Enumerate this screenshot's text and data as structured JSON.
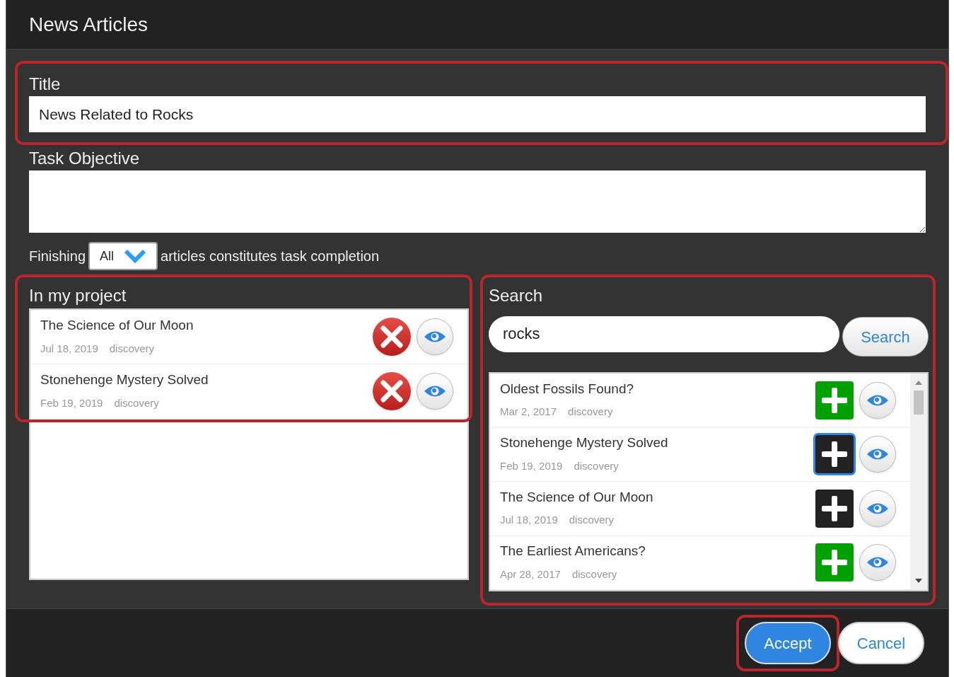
{
  "window": {
    "title": "News Articles"
  },
  "title_field": {
    "label": "Title",
    "value": "News Related to Rocks",
    "highlighted": true
  },
  "objective_field": {
    "label": "Task Objective"
  },
  "completion": {
    "prefix": "Finishing",
    "dropdown": "All",
    "suffix": "articles constitutes task completion"
  },
  "project": {
    "heading": "In my project",
    "highlighted": true,
    "items": [
      {
        "title": "The Science of Our Moon",
        "date": "Jul 18, 2019",
        "source": "discovery"
      },
      {
        "title": "Stonehenge Mystery Solved",
        "date": "Feb 19, 2019",
        "source": "discovery"
      }
    ]
  },
  "search": {
    "heading": "Search",
    "query": "rocks",
    "button": "Search",
    "highlighted": true,
    "results": [
      {
        "title": "Oldest Fossils Found?",
        "date": "Mar 2, 2017",
        "source": "discovery",
        "added": false,
        "focused": false
      },
      {
        "title": "Stonehenge Mystery Solved",
        "date": "Feb 19, 2019",
        "source": "discovery",
        "added": true,
        "focused": true
      },
      {
        "title": "The Science of Our Moon",
        "date": "Jul 18, 2019",
        "source": "discovery",
        "added": true,
        "focused": false
      },
      {
        "title": "The Earliest Americans?",
        "date": "Apr 28, 2017",
        "source": "discovery",
        "added": false,
        "focused": false
      }
    ]
  },
  "footer": {
    "buttons": [
      {
        "label": "Accept",
        "kind": "primary",
        "highlighted": true
      },
      {
        "label": "Cancel",
        "kind": "secondary",
        "highlighted": false
      }
    ]
  }
}
